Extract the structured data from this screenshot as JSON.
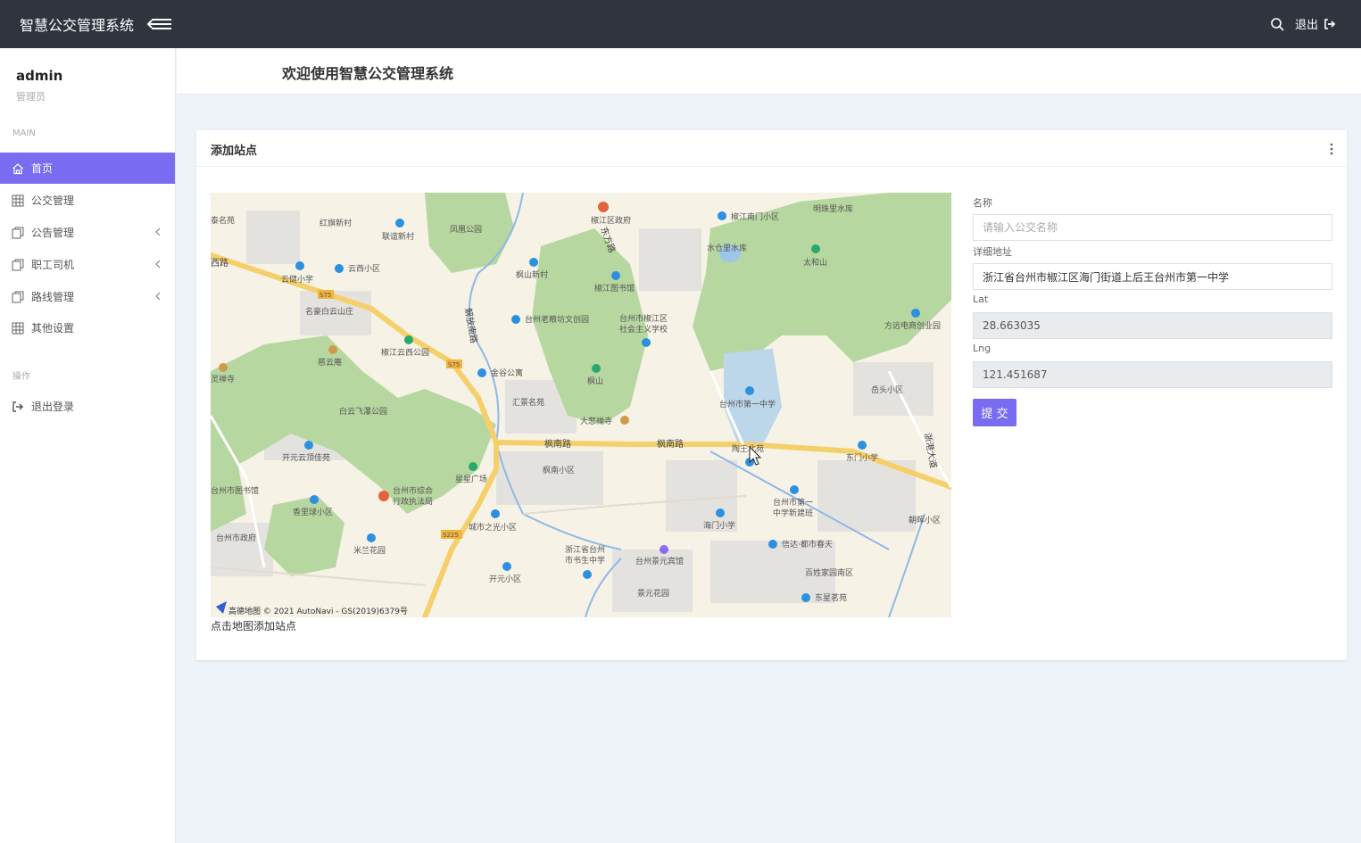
{
  "header": {
    "brand": "智慧公交管理系统",
    "logout_label": "退出",
    "icons": {
      "menu": "menu-toggle-icon",
      "search": "search-icon",
      "logout": "logout-icon"
    }
  },
  "sidebar": {
    "user_name": "admin",
    "user_role": "管理员",
    "section_main": "MAIN",
    "section_ops": "操作",
    "items": [
      {
        "label": "首页",
        "icon": "home-icon",
        "active": true,
        "expandable": false
      },
      {
        "label": "公交管理",
        "icon": "grid-icon",
        "active": false,
        "expandable": false
      },
      {
        "label": "公告管理",
        "icon": "copy-icon",
        "active": false,
        "expandable": true
      },
      {
        "label": "职工司机",
        "icon": "copy-icon",
        "active": false,
        "expandable": true
      },
      {
        "label": "路线管理",
        "icon": "copy-icon",
        "active": false,
        "expandable": true
      },
      {
        "label": "其他设置",
        "icon": "grid-icon",
        "active": false,
        "expandable": false
      }
    ],
    "logout_item": "退出登录"
  },
  "page": {
    "title": "欢迎使用智慧公交管理系统"
  },
  "card": {
    "title": "添加站点",
    "map_hint": "点击地图添加站点",
    "map": {
      "attribution": "高德地图 © 2021 AutoNavi - GS(2019)6379号",
      "roads": [
        "枫南路",
        "枫南路",
        "西路",
        "解放南路",
        "东方路",
        "浙港大道"
      ],
      "labels": [
        "椒江区政府",
        "椒江南门小区",
        "明珠里水库",
        "水仓里水库",
        "太和山",
        "凤凰公园",
        "联谊新村",
        "红旗新村",
        "云健小学",
        "云西小区",
        "名豪白云山庄",
        "枫山新村",
        "椒江图书馆",
        "台州老粮坊文创园",
        "台州市椒江区社会主义学校",
        "方远电商创业园",
        "慈云庵",
        "椒江云西公园",
        "金谷公寓",
        "枫山",
        "汇景名苑",
        "台州市第一中学",
        "岳头小区",
        "白云飞瀑公园",
        "大悲禅寺",
        "开元云顶佳苑",
        "陶王北苑",
        "东门小学",
        "枫南小区",
        "星星广场",
        "台州市综合行政执法局",
        "香里球小区",
        "城市之光小区",
        "台州市第一中学新建班",
        "海门小学",
        "朝晖小区",
        "米兰花园",
        "浙江省台州市书生中学",
        "台州景元宾馆",
        "信达·都市春天",
        "百姓家园南区",
        "开元小区",
        "景元花园",
        "东星茗苑",
        "台州市政府",
        "台州市图书馆",
        "灵禅寺",
        "S75",
        "S225"
      ]
    }
  },
  "form": {
    "name_label": "名称",
    "name_placeholder": "请输入公交名称",
    "name_value": "",
    "address_label": "详细地址",
    "address_value": "浙江省台州市椒江区海门街道上后王台州市第一中学",
    "lat_label": "Lat",
    "lat_value": "28.663035",
    "lng_label": "Lng",
    "lng_value": "121.451687",
    "submit_label": "提 交"
  },
  "colors": {
    "accent": "#7a6cf0",
    "topbar": "#2f343d",
    "map_green": "#b7d7a0",
    "road_yellow": "#f5cf6a"
  }
}
